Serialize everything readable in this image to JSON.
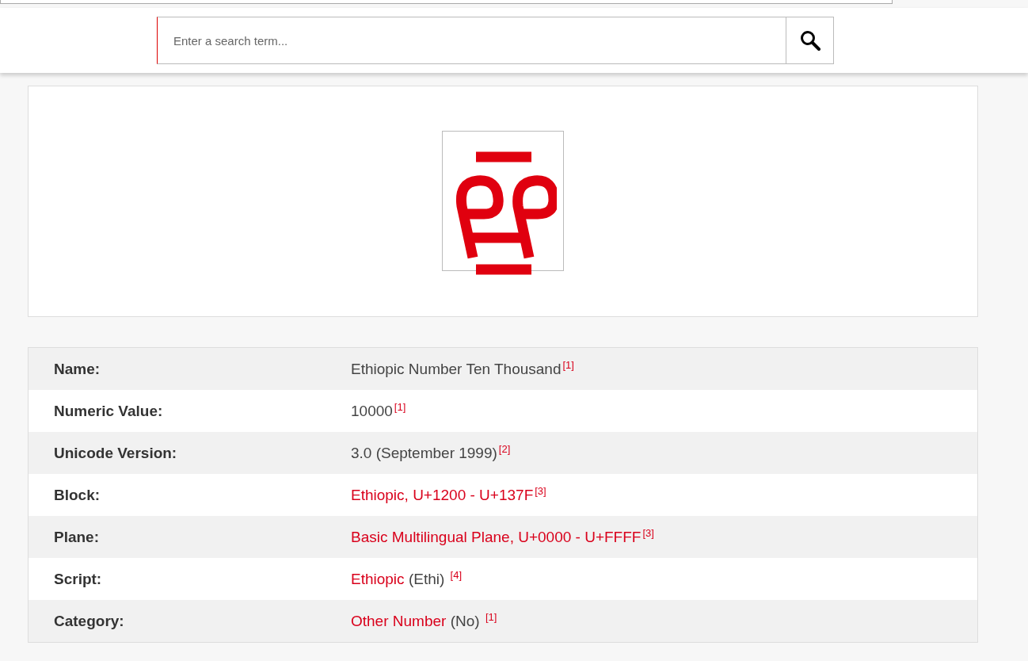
{
  "search": {
    "placeholder": "Enter a search term..."
  },
  "properties": [
    {
      "label": "Name:",
      "value": [
        {
          "kind": "plain",
          "text": "Ethiopic Number Ten Thousand"
        }
      ],
      "ref": "[1]"
    },
    {
      "label": "Numeric Value:",
      "value": [
        {
          "kind": "plain",
          "text": "10000"
        }
      ],
      "ref": "[1]"
    },
    {
      "label": "Unicode Version:",
      "value": [
        {
          "kind": "plain",
          "text": "3.0 (September 1999)"
        }
      ],
      "ref": "[2]"
    },
    {
      "label": "Block:",
      "value": [
        {
          "kind": "link",
          "text": "Ethiopic, U+1200 - U+137F"
        }
      ],
      "ref": "[3]"
    },
    {
      "label": "Plane:",
      "value": [
        {
          "kind": "link",
          "text": "Basic Multilingual Plane, U+0000 - U+FFFF"
        }
      ],
      "ref": "[3]"
    },
    {
      "label": "Script:",
      "value": [
        {
          "kind": "link",
          "text": "Ethiopic"
        },
        {
          "kind": "plain",
          "text": " (Ethi) "
        }
      ],
      "ref": "[4]"
    },
    {
      "label": "Category:",
      "value": [
        {
          "kind": "link",
          "text": "Other Number"
        },
        {
          "kind": "plain",
          "text": " (No) "
        }
      ],
      "ref": "[1]"
    }
  ]
}
